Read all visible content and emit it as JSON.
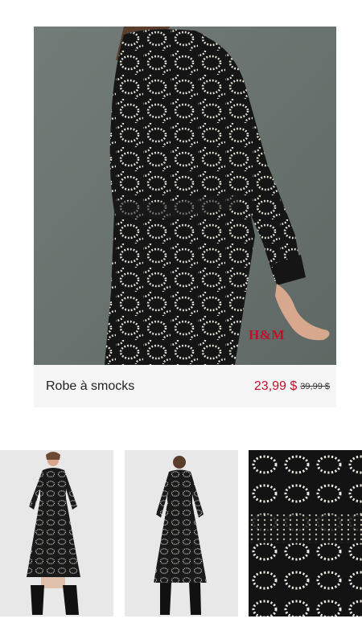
{
  "brand": {
    "logo_text": "H&M",
    "accent_color": "#c0102a"
  },
  "product": {
    "name": "Robe à smocks",
    "price_current": "23,99 $",
    "price_original": "39,99 $"
  },
  "images": {
    "hero": {
      "icon": "model-side-view-image"
    },
    "thumbnails": [
      {
        "name": "front-view"
      },
      {
        "name": "back-view"
      },
      {
        "name": "fabric-detail"
      }
    ]
  }
}
